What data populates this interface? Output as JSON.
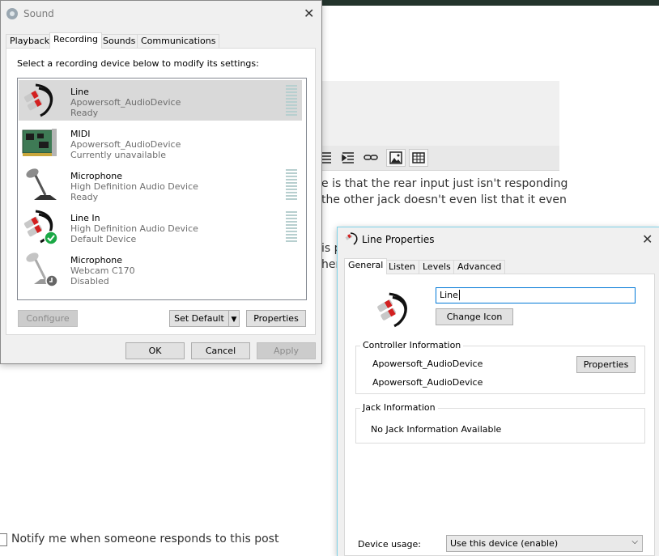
{
  "background_page": {
    "editor_line1": "e is that the rear input just isn't responding",
    "editor_line2": "the other jack doesn't even list that it even",
    "editor_line3": "is p",
    "editor_line4": "her",
    "notify_text": "Notify me when someone responds to this post"
  },
  "sound_dialog": {
    "title": "Sound",
    "tabs": [
      "Playback",
      "Recording",
      "Sounds",
      "Communications"
    ],
    "active_tab": "Recording",
    "instruction": "Select a recording device below to modify its settings:",
    "devices": [
      {
        "name": "Line",
        "driver": "Apowersoft_AudioDevice",
        "status": "Ready",
        "selected": true,
        "icon": "rca-cable-icon"
      },
      {
        "name": "MIDI",
        "driver": "Apowersoft_AudioDevice",
        "status": "Currently unavailable",
        "selected": false,
        "icon": "circuit-board-icon"
      },
      {
        "name": "Microphone",
        "driver": "High Definition Audio Device",
        "status": "Ready",
        "selected": false,
        "icon": "microphone-icon"
      },
      {
        "name": "Line In",
        "driver": "High Definition Audio Device",
        "status": "Default Device",
        "selected": false,
        "icon": "rca-cable-default-icon"
      },
      {
        "name": "Microphone",
        "driver": "Webcam C170",
        "status": "Disabled",
        "selected": false,
        "icon": "microphone-disabled-icon"
      }
    ],
    "buttons": {
      "configure": "Configure",
      "set_default": "Set Default",
      "properties": "Properties",
      "ok": "OK",
      "cancel": "Cancel",
      "apply": "Apply"
    }
  },
  "line_properties": {
    "title": "Line Properties",
    "tabs": [
      "General",
      "Listen",
      "Levels",
      "Advanced"
    ],
    "active_tab": "General",
    "name_value": "Line",
    "change_icon": "Change Icon",
    "controller_group": "Controller Information",
    "controller_line1": "Apowersoft_AudioDevice",
    "controller_line2": "Apowersoft_AudioDevice",
    "controller_properties": "Properties",
    "jack_group": "Jack Information",
    "jack_text": "No Jack Information Available",
    "device_usage_label": "Device usage:",
    "device_usage_value": "Use this device (enable)"
  }
}
